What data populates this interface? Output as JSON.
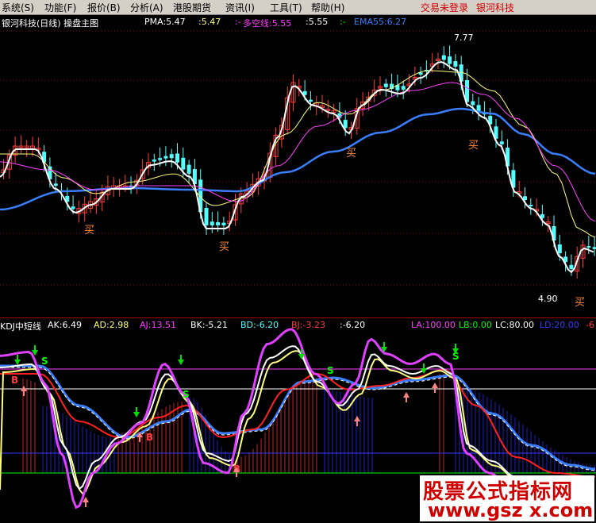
{
  "menu": {
    "items": [
      "系统(S)",
      "功能(F)",
      "报价(B)",
      "分析(A)",
      "港股期货",
      "资讯(I)",
      "工具(T)",
      "帮助(H)"
    ],
    "status": "交易未登录",
    "broker": "银河科技"
  },
  "main_panel": {
    "title": "银河科技(日线) 操盘主图",
    "pma": "PMA:5.47",
    "pma2": ":5.47",
    "duo": "多空线:5.55",
    "duo2": ":5.55",
    "dash": ":-",
    "ema": "EMA55:6.27",
    "high_label": "7.77",
    "low_label": "4.90",
    "buy_label": "买"
  },
  "sub_panel": {
    "title": "KDJ中短线",
    "ak": "AK:6.49",
    "ad": "AD:2.98",
    "aj": "AJ:13.51",
    "bk": "BK:-5.21",
    "bd": "BD:-6.20",
    "bj": "BJ:-3.23",
    "extra": ":-6.20",
    "la": "LA:100.00",
    "lb": "LB:0.00",
    "lc": "LC:80.00",
    "ld": "LD:20.00",
    "trunc": "-6",
    "sell_label": "S",
    "buy_label": "B"
  },
  "watermark": {
    "line1": "股票公式指标网",
    "line2": "www.gsz x.com"
  },
  "colors": {
    "up": "#ff3c3c",
    "down": "#54ffff",
    "ema": "#3a7fff",
    "line_white": "#ffffff",
    "line_yellow": "#ffff80",
    "line_magenta": "#ff40ff"
  }
}
